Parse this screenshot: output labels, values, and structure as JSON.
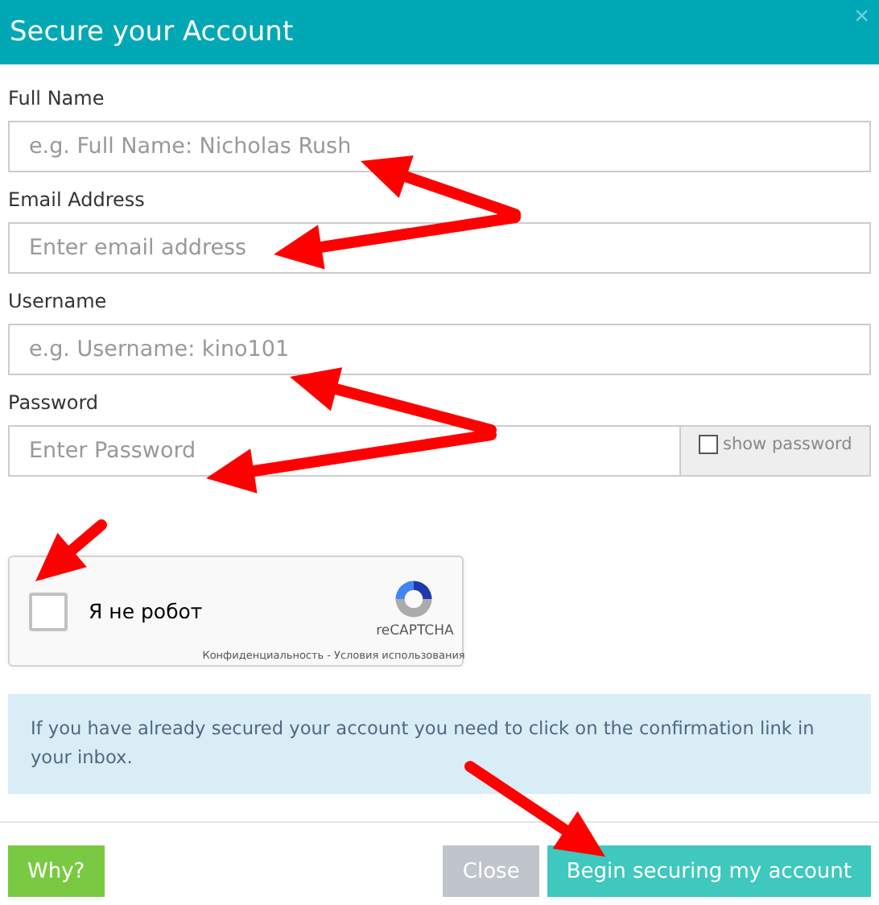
{
  "modal": {
    "title": "Secure your Account",
    "close": "×"
  },
  "fields": [
    {
      "label": "Full Name",
      "placeholder": "e.g. Full Name: Nicholas Rush"
    },
    {
      "label": "Email Address",
      "placeholder": "Enter email address"
    },
    {
      "label": "Username",
      "placeholder": "e.g. Username: kino101"
    },
    {
      "label": "Password",
      "placeholder": "Enter Password",
      "toggle": {
        "label": "show password",
        "checked": false
      }
    }
  ],
  "captcha": {
    "label": "Я не робот",
    "checked": false,
    "brand": "reCAPTCHA",
    "privacy": "Конфиденциальность",
    "separator": "-",
    "terms": "Условия использования"
  },
  "info": "If you have already secured your account you need to click on the confirmation link in your inbox.",
  "buttons": [
    {
      "label": "Why?",
      "kind": "why"
    },
    {
      "label": "Close",
      "kind": "close"
    },
    {
      "label": "Begin securing my account",
      "kind": "primary"
    }
  ]
}
